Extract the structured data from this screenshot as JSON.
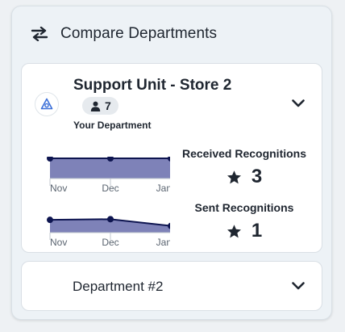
{
  "panel": {
    "title": "Compare Departments",
    "icon": "swap-arrows-icon"
  },
  "department_1": {
    "name": "Support Unit - Store 2",
    "member_count": "7",
    "subtitle": "Your Department",
    "received": {
      "label": "Received Recognitions",
      "value": "3"
    },
    "sent": {
      "label": "Sent Recognitions",
      "value": "1"
    }
  },
  "department_2": {
    "name": "Department #2"
  },
  "colors": {
    "line": "#0e1550",
    "fill": "#7e82b8",
    "axis": "#c3c9cf"
  },
  "chart_data": [
    {
      "type": "area",
      "categories": [
        "Nov",
        "Dec",
        "Jan"
      ],
      "series": [
        {
          "values": [
            3,
            3,
            3
          ]
        }
      ],
      "ylim": [
        0,
        3
      ]
    },
    {
      "type": "area",
      "categories": [
        "Nov",
        "Dec",
        "Jan"
      ],
      "series": [
        {
          "values": [
            1.9,
            2.0,
            1.0
          ]
        }
      ],
      "ylim": [
        0,
        3
      ]
    }
  ]
}
